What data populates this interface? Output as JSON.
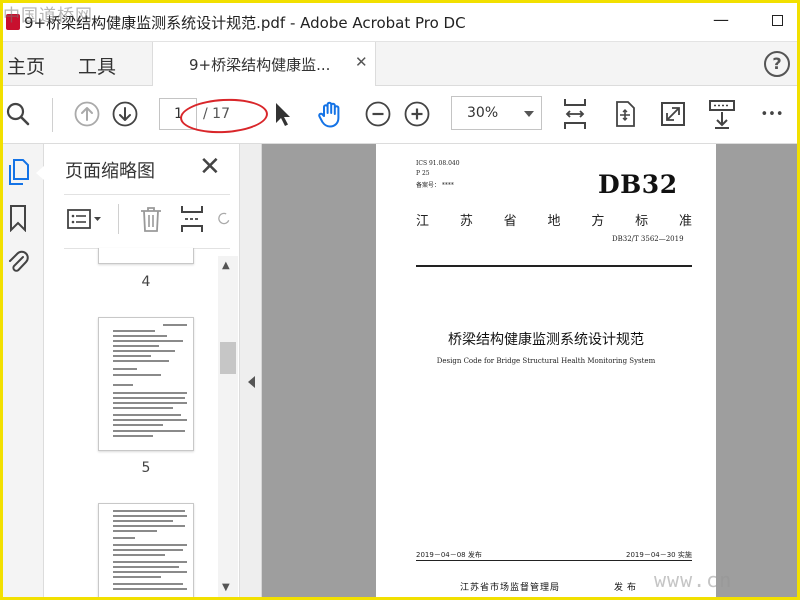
{
  "window": {
    "title": "9+桥梁结构健康监测系统设计规范.pdf - Adobe Acrobat Pro DC",
    "minimize_glyph": "—"
  },
  "watermarks": {
    "top_left": "中国道桥网",
    "bottom_right": "www.cn"
  },
  "nav": {
    "home": "主页",
    "tools": "工具",
    "doc_tab_label": "9+桥梁结构健康监...",
    "help": "?"
  },
  "toolbar": {
    "current_page": "1",
    "total_pages": "/ 17",
    "zoom": "30%",
    "more": "•••"
  },
  "thumbnails_panel": {
    "title": "页面缩略图",
    "page_labels": [
      "4",
      "5"
    ]
  },
  "document": {
    "ics": "ICS  91.08.040",
    "p": "P  25",
    "filing": "备案号： ****",
    "logo": "DB32",
    "standard_chars": [
      "江",
      "苏",
      "省",
      "地",
      "方",
      "标",
      "准"
    ],
    "code": "DB32/T  3562—2019",
    "title_cn": "桥梁结构健康监测系统设计规范",
    "title_en": "Design Code for Bridge Structural Health Monitoring System",
    "issue_date": "2019－04－08 发布",
    "impl_date": "2019－04－30 实施",
    "issuer": "江苏省市场监督管理局",
    "publish": "发布"
  },
  "colors": {
    "frame": "#f2e000",
    "annotation": "#d9262a",
    "accent_blue": "#1473e6",
    "doc_background": "#9e9e9e"
  },
  "icons": [
    "acrobat-icon",
    "search-icon",
    "prev-page-icon",
    "next-page-icon",
    "select-cursor-icon",
    "hand-tool-icon",
    "zoom-out-icon",
    "zoom-in-icon",
    "fit-page-icon",
    "rotate-icon",
    "full-screen-icon",
    "scrolling-mode-icon",
    "more-icon",
    "page-thumbnails-icon",
    "bookmark-icon",
    "attachment-icon",
    "options-menu-icon",
    "delete-page-icon",
    "insert-page-icon",
    "rotate-page-icon"
  ]
}
